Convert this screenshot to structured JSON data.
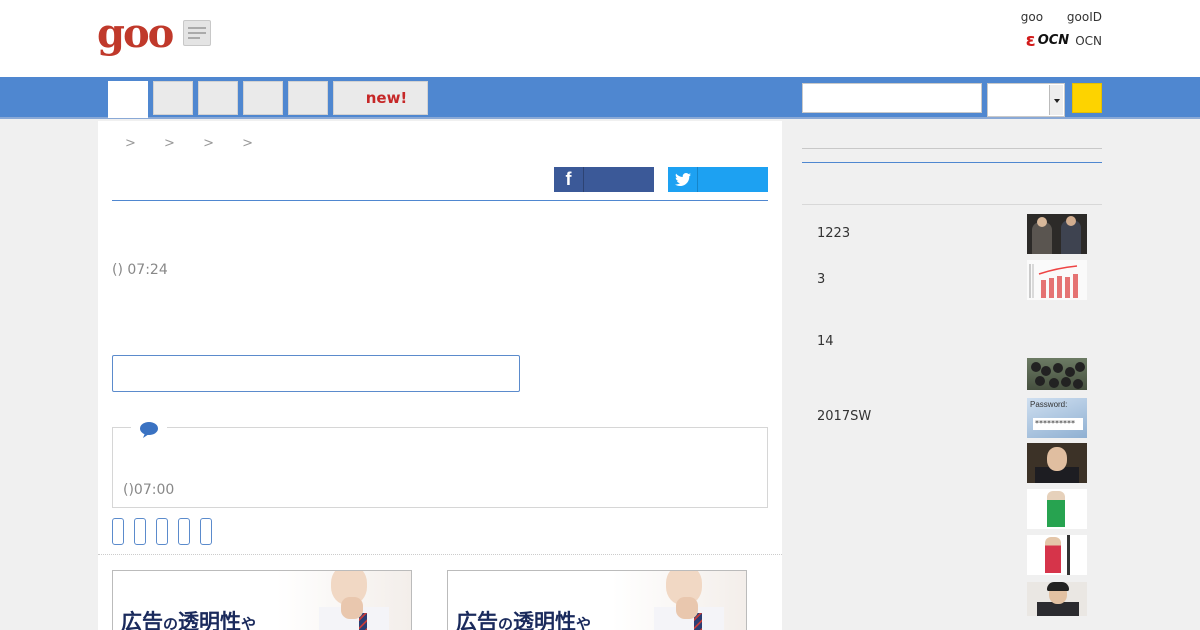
{
  "header": {
    "logo_text": "goo",
    "top_links": [
      "goo",
      "gooID"
    ],
    "ocn_label": "OCN",
    "ocn_logo_text": "OCN"
  },
  "nav": {
    "tabs": [
      "",
      "",
      "",
      "",
      ""
    ],
    "new_tab_label": "new!",
    "search_placeholder": "",
    "select_value": ""
  },
  "article": {
    "breadcrumb": [
      ">",
      ">",
      ">",
      ">"
    ],
    "share": {
      "facebook_label": "",
      "twitter_label": ""
    },
    "timestamp": "() 07:24",
    "comment_input_placeholder": "",
    "comment": {
      "time": "()07:00"
    },
    "pager_count": 5
  },
  "ads": [
    {
      "headline": "広告",
      "particle": "の",
      "subhead": "透明性",
      "tail": "や"
    },
    {
      "headline": "広告",
      "particle": "の",
      "subhead": "透明性",
      "tail": "や"
    }
  ],
  "sidebar": {
    "items": [
      "1223",
      "3",
      "14",
      "2017SW"
    ],
    "password_thumb_label": "Password:",
    "password_thumb_dots": "**********"
  },
  "colors": {
    "nav_blue": "#4f87d0",
    "goo_red": "#c0392b",
    "new_red": "#c62828",
    "facebook": "#3b5998",
    "twitter": "#1da1f2",
    "search_button": "#fdd300"
  }
}
